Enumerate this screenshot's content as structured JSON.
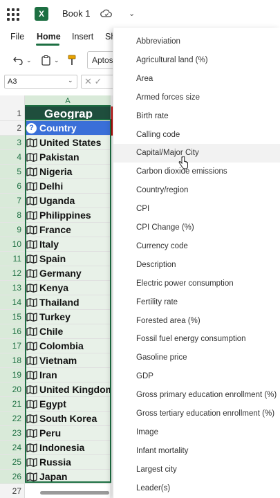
{
  "titlebar": {
    "app_logo": "X",
    "book_title": "Book 1"
  },
  "ribbon": {
    "tabs": [
      "File",
      "Home",
      "Insert",
      "Sh"
    ],
    "font_name": "Aptos"
  },
  "formula_bar": {
    "name_box": "A3",
    "fx_text": "✕ ✓"
  },
  "grid": {
    "column_header": "A",
    "banner_text": "Geograp",
    "header_text": "Country",
    "rows": [
      {
        "num": "1"
      },
      {
        "num": "2"
      },
      {
        "num": "3",
        "text": "United States"
      },
      {
        "num": "4",
        "text": "Pakistan"
      },
      {
        "num": "5",
        "text": "Nigeria"
      },
      {
        "num": "6",
        "text": "Delhi"
      },
      {
        "num": "7",
        "text": "Uganda"
      },
      {
        "num": "8",
        "text": "Philippines"
      },
      {
        "num": "9",
        "text": "France"
      },
      {
        "num": "10",
        "text": "Italy"
      },
      {
        "num": "11",
        "text": "Spain"
      },
      {
        "num": "12",
        "text": "Germany"
      },
      {
        "num": "13",
        "text": "Kenya"
      },
      {
        "num": "14",
        "text": "Thailand"
      },
      {
        "num": "15",
        "text": "Turkey"
      },
      {
        "num": "16",
        "text": "Chile"
      },
      {
        "num": "17",
        "text": "Colombia"
      },
      {
        "num": "18",
        "text": "Vietnam"
      },
      {
        "num": "19",
        "text": "Iran"
      },
      {
        "num": "20",
        "text": "United Kingdom"
      },
      {
        "num": "21",
        "text": "Egypt"
      },
      {
        "num": "22",
        "text": "South Korea"
      },
      {
        "num": "23",
        "text": "Peru"
      },
      {
        "num": "24",
        "text": "Indonesia"
      },
      {
        "num": "25",
        "text": "Russia"
      },
      {
        "num": "26",
        "text": "Japan"
      },
      {
        "num": "27"
      }
    ]
  },
  "dropdown": {
    "items": [
      "Abbreviation",
      "Agricultural land (%)",
      "Area",
      "Armed forces size",
      "Birth rate",
      "Calling code",
      "Capital/Major City",
      "Carbon dioxide emissions",
      "Country/region",
      "CPI",
      "CPI Change (%)",
      "Currency code",
      "Description",
      "Electric power consumption",
      "Fertility rate",
      "Forested area (%)",
      "Fossil fuel energy consumption",
      "Gasoline price",
      "GDP",
      "Gross primary education enrollment (%)",
      "Gross tertiary education enrollment (%)",
      "Image",
      "Infant mortality",
      "Largest city",
      "Leader(s)"
    ],
    "hover_index": 6
  },
  "colors": {
    "excel_green": "#1d6f42",
    "banner": "#1f4e3d",
    "header_blue": "#3a6fd8"
  }
}
